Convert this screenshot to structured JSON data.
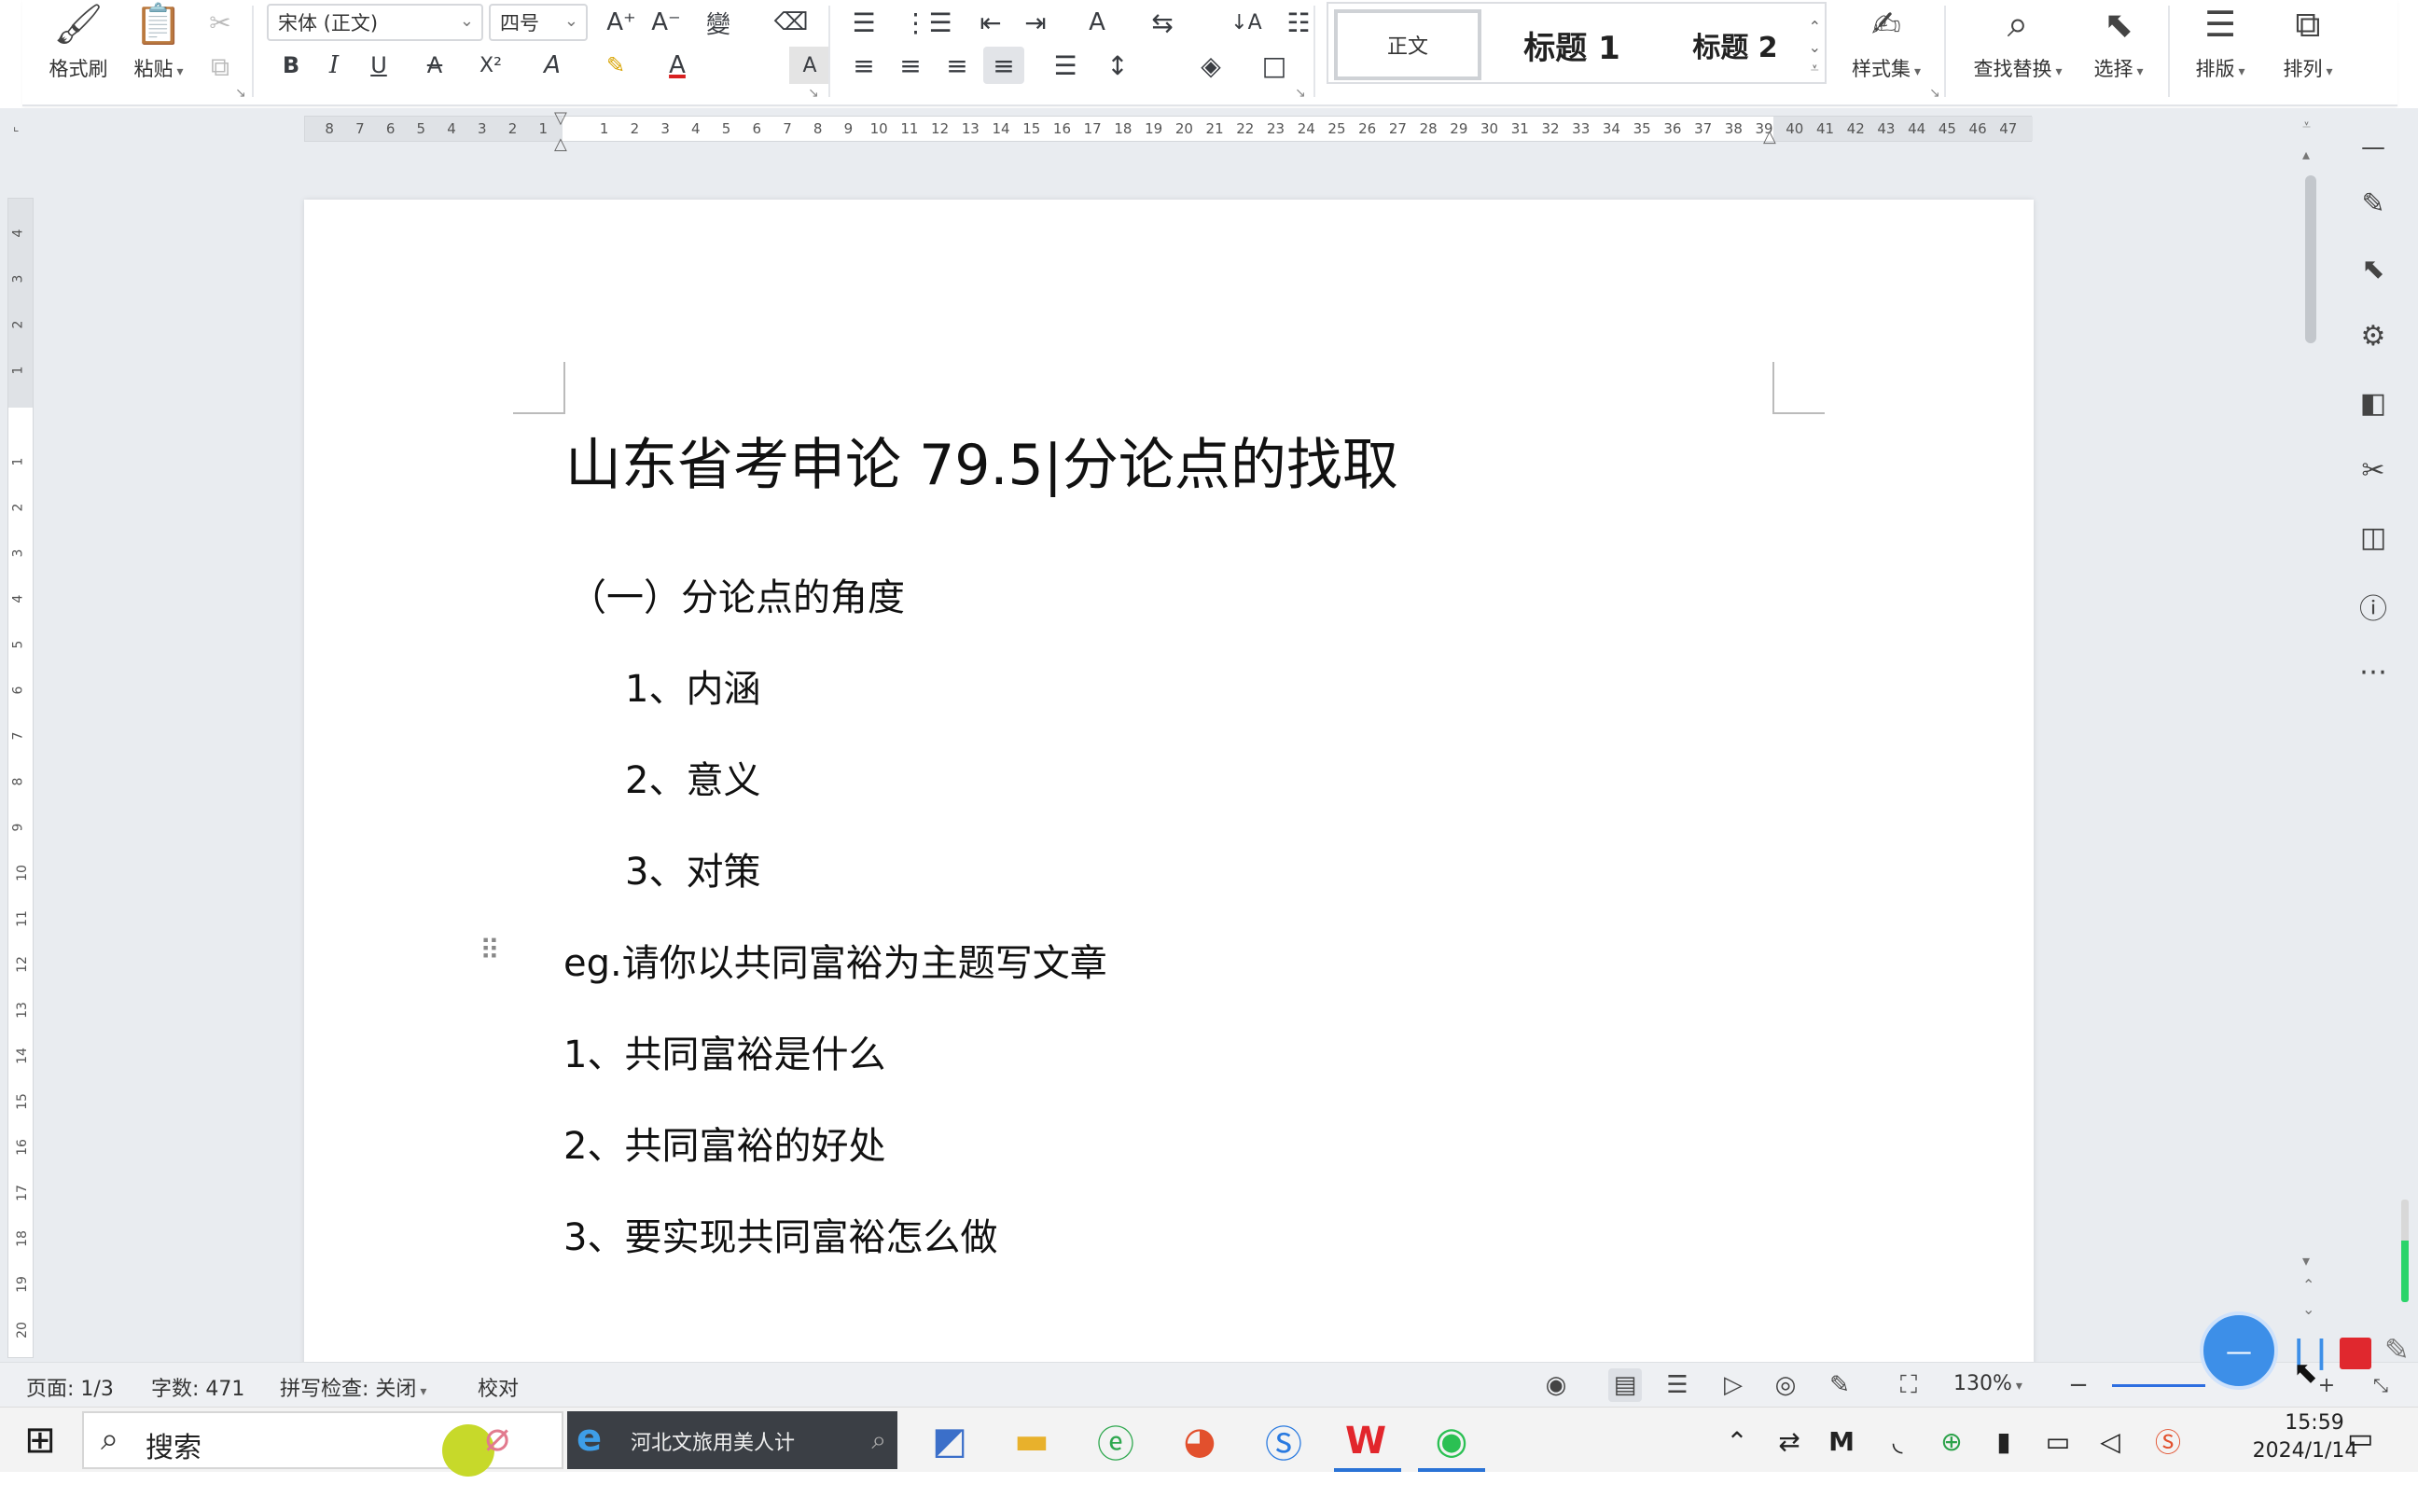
{
  "ribbon": {
    "format_painter": "格式刷",
    "paste": "粘贴",
    "font_name": "宋体 (正文)",
    "font_size": "四号",
    "styles": {
      "normal": "正文",
      "heading1": "标题 1",
      "heading2": "标题 2"
    },
    "style_set": "样式集",
    "find_replace": "查找替换",
    "select": "选择",
    "layout": "排版",
    "arrange": "排列",
    "icons": {
      "grow": "A⁺",
      "shrink": "A⁻",
      "phonetic": "變",
      "clear": "⌫",
      "bold": "B",
      "italic": "I",
      "underline": "U",
      "strike": "A",
      "superscript": "X²",
      "text_effect": "A",
      "highlight": "✎",
      "font_color": "A",
      "char_shade": "A",
      "bullets": "☰",
      "numbering": "⋮☰",
      "outdent": "⇤",
      "indent": "⇥",
      "text_dir": "A",
      "convert": "⇆",
      "sort": "↓A",
      "columns": "☷",
      "align_left": "≡",
      "align_center": "≡",
      "align_right": "≡",
      "justify": "≡",
      "distribute": "☰",
      "line_spacing": "↕",
      "shading": "◈",
      "border": "□"
    }
  },
  "ruler": {
    "h_numbers": [
      "8",
      "7",
      "6",
      "5",
      "4",
      "3",
      "2",
      "1",
      "",
      "1",
      "2",
      "3",
      "4",
      "5",
      "6",
      "7",
      "8",
      "9",
      "10",
      "11",
      "12",
      "13",
      "14",
      "15",
      "16",
      "17",
      "18",
      "19",
      "20",
      "21",
      "22",
      "23",
      "24",
      "25",
      "26",
      "27",
      "28",
      "29",
      "30",
      "31",
      "32",
      "33",
      "34",
      "35",
      "36",
      "37",
      "38",
      "39",
      "40",
      "41",
      "42",
      "43",
      "44",
      "45",
      "46",
      "47"
    ],
    "v_numbers": [
      "4",
      "3",
      "2",
      "1",
      "",
      "1",
      "2",
      "3",
      "4",
      "5",
      "6",
      "7",
      "8",
      "9",
      "10",
      "11",
      "12",
      "13",
      "14",
      "15",
      "16",
      "17",
      "18",
      "19",
      "20"
    ]
  },
  "document": {
    "title": "山东省考申论 79.5|分论点的找取",
    "lines": [
      "（一）分论点的角度",
      "1、内涵",
      "2、意义",
      "3、对策",
      "eg.请你以共同富裕为主题写文章",
      "1、共同富裕是什么",
      "2、共同富裕的好处",
      "3、要实现共同富裕怎么做"
    ]
  },
  "status": {
    "page": "页面: 1/3",
    "word_count": "字数: 471",
    "spell_check": "拼写检查: 关闭",
    "proofread": "校对",
    "zoom": "130%"
  },
  "recorder": {
    "pause": "| |",
    "progress_pct": 40,
    "circle_glyph": "—"
  },
  "taskbar": {
    "search_text": "搜索",
    "active_task": "河北文旅用美人计",
    "clock_time": "15:59",
    "clock_date": "2024/1/14",
    "colors": {
      "wps": "#e2262c",
      "wechat": "#2bc053",
      "accent": "#2a73d6"
    }
  }
}
